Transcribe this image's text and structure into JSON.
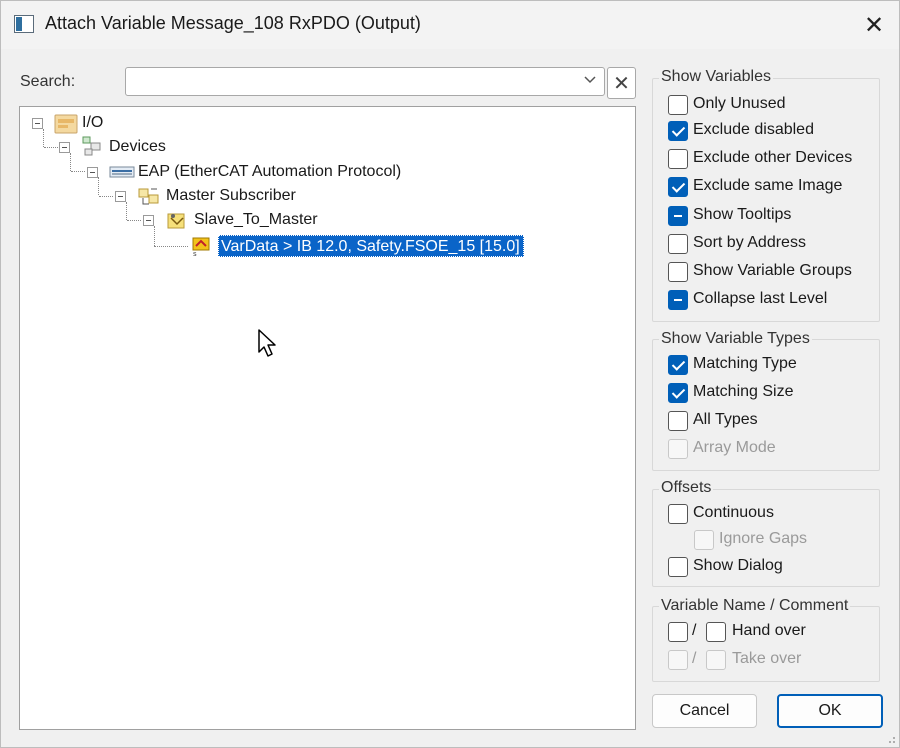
{
  "window": {
    "title": "Attach Variable Message_108 RxPDO (Output)",
    "close_glyph": "✕"
  },
  "search": {
    "label": "Search:",
    "value": "",
    "placeholder": "",
    "dropdown_icon": "chevron-down-icon",
    "clear_glyph": "✕"
  },
  "tree": {
    "nodes": [
      {
        "label": "I/O",
        "icon": "io-folder-icon"
      },
      {
        "label": "Devices",
        "icon": "devices-icon"
      },
      {
        "label": "EAP (EtherCAT Automation Protocol)",
        "icon": "eap-network-icon"
      },
      {
        "label": "Master Subscriber",
        "icon": "subscriber-icon"
      },
      {
        "label": "Slave_To_Master",
        "icon": "variable-group-icon"
      },
      {
        "label": "VarData    >    IB 12.0, Safety.FSOE_15 [15.0]",
        "icon": "variable-icon",
        "selected": true
      }
    ]
  },
  "show_variables": {
    "title": "Show Variables",
    "items": [
      {
        "label": "Only Unused",
        "state": "unchecked"
      },
      {
        "label": "Exclude disabled",
        "state": "checked"
      },
      {
        "label": "Exclude other Devices",
        "state": "unchecked"
      },
      {
        "label": "Exclude same Image",
        "state": "checked"
      },
      {
        "label": "Show Tooltips",
        "state": "indeterminate"
      },
      {
        "label": "Sort by Address",
        "state": "unchecked"
      },
      {
        "label": "Show Variable Groups",
        "state": "unchecked"
      },
      {
        "label": "Collapse last Level",
        "state": "indeterminate"
      }
    ]
  },
  "show_variable_types": {
    "title": "Show Variable Types",
    "items": [
      {
        "label": "Matching Type",
        "state": "checked"
      },
      {
        "label": "Matching Size",
        "state": "checked"
      },
      {
        "label": "All Types",
        "state": "unchecked"
      },
      {
        "label": "Array Mode",
        "state": "disabled"
      }
    ]
  },
  "offsets": {
    "title": "Offsets",
    "items": [
      {
        "label": "Continuous",
        "state": "unchecked"
      },
      {
        "label": "Ignore Gaps",
        "state": "disabled"
      },
      {
        "label": "Show Dialog",
        "state": "unchecked"
      }
    ]
  },
  "variable_name_comment": {
    "title": "Variable Name / Comment",
    "slash": "/",
    "rows": [
      {
        "label": "Hand over",
        "state": "unchecked"
      },
      {
        "label": "Take over",
        "state": "disabled"
      }
    ]
  },
  "buttons": {
    "cancel": "Cancel",
    "ok": "OK"
  }
}
